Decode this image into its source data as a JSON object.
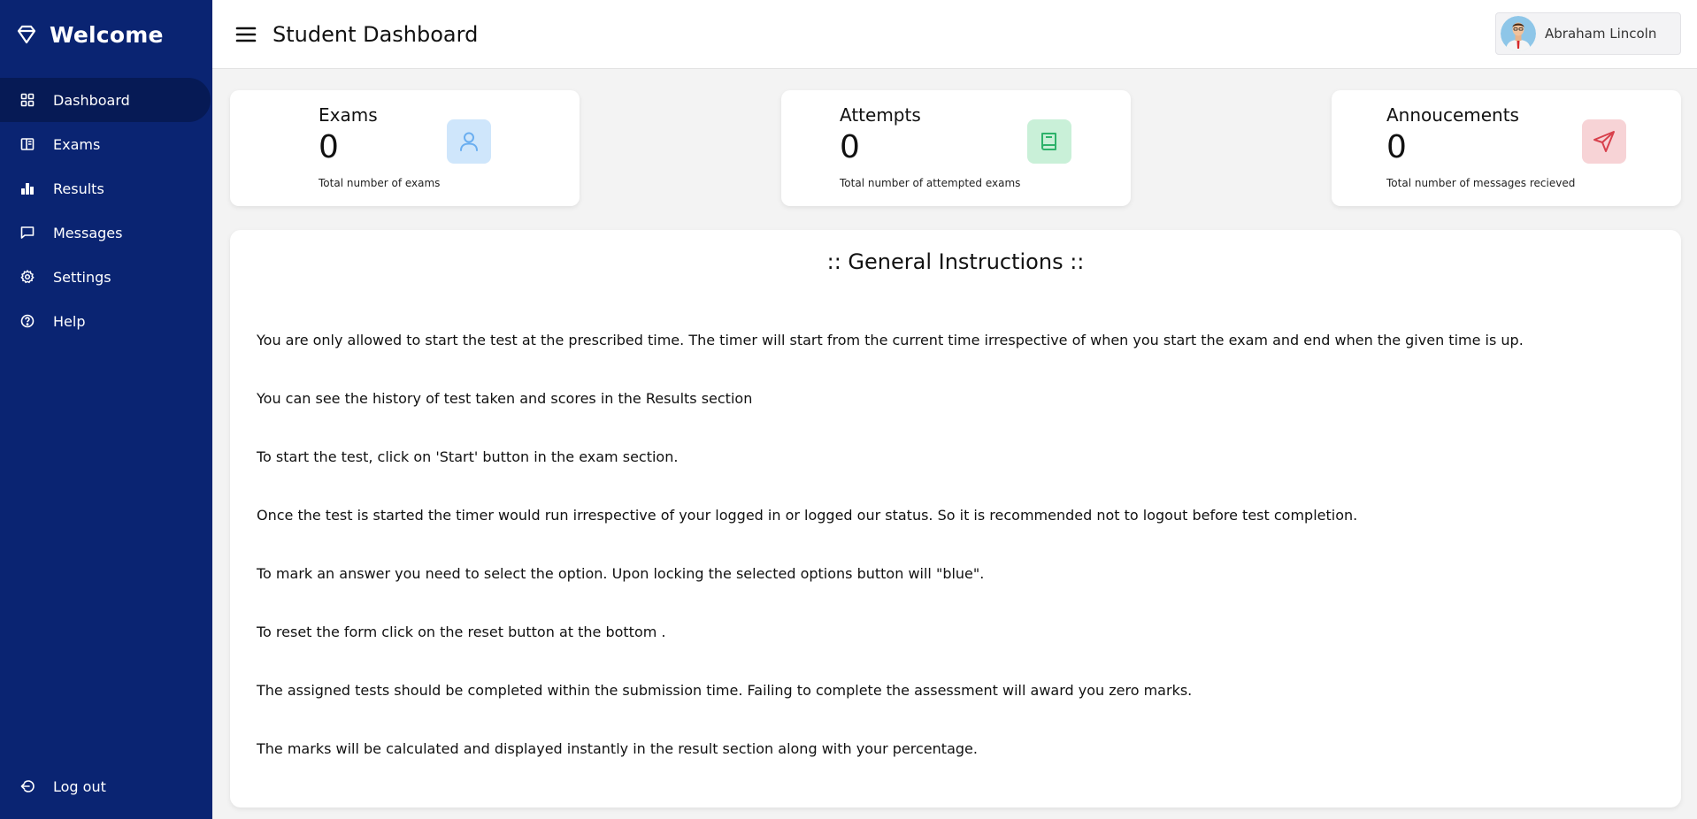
{
  "sidebar": {
    "brand": "Welcome",
    "items": [
      {
        "label": "Dashboard",
        "icon": "grid-icon"
      },
      {
        "label": "Exams",
        "icon": "book-open-icon"
      },
      {
        "label": "Results",
        "icon": "bar-chart-icon"
      },
      {
        "label": "Messages",
        "icon": "message-icon"
      },
      {
        "label": "Settings",
        "icon": "gear-icon"
      },
      {
        "label": "Help",
        "icon": "help-circle-icon"
      }
    ],
    "logout": "Log out",
    "active_item": "Dashboard"
  },
  "header": {
    "title": "Student Dashboard",
    "user_name": "Abraham Lincoln"
  },
  "cards": [
    {
      "title": "Exams",
      "value": "0",
      "desc": "Total number of exams",
      "icon": "user-icon",
      "icon_color": "#6aaef0",
      "icon_bg": "#cfe6fb"
    },
    {
      "title": "Attempts",
      "value": "0",
      "desc": "Total number of attempted exams",
      "icon": "book-icon",
      "icon_color": "#2db26a",
      "icon_bg": "#c9f0d8"
    },
    {
      "title": "Annoucements",
      "value": "0",
      "desc": "Total number of messages recieved",
      "icon": "send-icon",
      "icon_color": "#d8404c",
      "icon_bg": "#f7d3d6"
    }
  ],
  "instructions": {
    "title": ":: General Instructions ::",
    "items": [
      "You are only allowed to start the test at the prescribed time. The timer will start from the current time irrespective of when you start the exam and end when the given time is up.",
      "You can see the history of test taken and scores in the Results section",
      "To start the test, click on 'Start' button in the exam section.",
      "Once the test is started the timer would run irrespective of your logged in or logged our status. So it is recommended not to logout before test completion.",
      "To mark an answer you need to select the option. Upon locking the selected options button will \"blue\".",
      "To reset the form click on the reset button at the bottom .",
      "The assigned tests should be completed within the submission time. Failing to complete the assessment will award you zero marks.",
      "The marks will be calculated and displayed instantly in the result section along with your percentage."
    ]
  },
  "colors": {
    "sidebar_bg": "#0a2472",
    "sidebar_active_bg": "#061a55",
    "page_bg": "#f3f3f3"
  }
}
